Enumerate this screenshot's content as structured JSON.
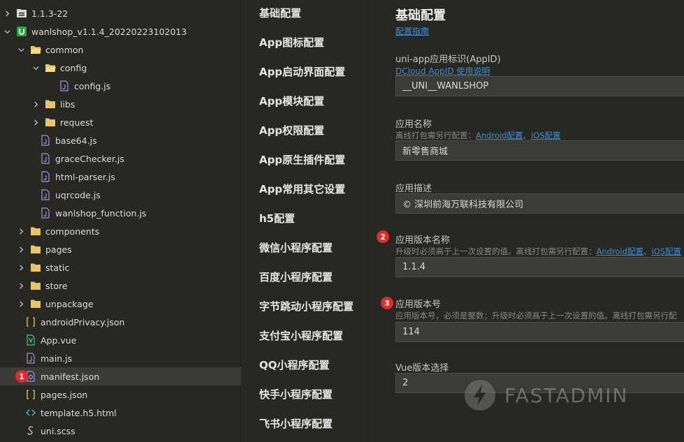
{
  "tree": {
    "rows": [
      {
        "label": "1.1.3-22"
      },
      {
        "label": "wanlshop_v1.1.4_20220223102013"
      },
      {
        "label": "common"
      },
      {
        "label": "config"
      },
      {
        "label": "config.js"
      },
      {
        "label": "libs"
      },
      {
        "label": "request"
      },
      {
        "label": "base64.js"
      },
      {
        "label": "graceChecker.js"
      },
      {
        "label": "html-parser.js"
      },
      {
        "label": "uqrcode.js"
      },
      {
        "label": "wanlshop_function.js"
      },
      {
        "label": "components"
      },
      {
        "label": "pages"
      },
      {
        "label": "static"
      },
      {
        "label": "store"
      },
      {
        "label": "unpackage"
      },
      {
        "label": "androidPrivacy.json"
      },
      {
        "label": "App.vue"
      },
      {
        "label": "main.js"
      },
      {
        "label": "manifest.json"
      },
      {
        "label": "pages.json"
      },
      {
        "label": "template.h5.html"
      },
      {
        "label": "uni.scss"
      }
    ]
  },
  "badges": {
    "one": "1",
    "two": "2",
    "three": "3"
  },
  "nav": {
    "items": [
      "基础配置",
      "App图标配置",
      "App启动界面配置",
      "App模块配置",
      "App权限配置",
      "App原生插件配置",
      "App常用其它设置",
      "h5配置",
      "微信小程序配置",
      "百度小程序配置",
      "字节跳动小程序配置",
      "支付宝小程序配置",
      "QQ小程序配置",
      "快手小程序配置",
      "飞书小程序配置"
    ]
  },
  "settings": {
    "title": "基础配置",
    "guide_link": "配置指南",
    "appid": {
      "label": "uni-app应用标识(AppID)",
      "link": "DCloud AppID 使用说明",
      "value": "__UNI__WANLSHOP"
    },
    "name": {
      "label": "应用名称",
      "hint_prefix": "离线打包需另行配置：",
      "hint_link1": "Android配置",
      "hint_sep": "、",
      "hint_link2": "iOS配置",
      "value": "新零售商城"
    },
    "desc": {
      "label": "应用描述",
      "value": "© 深圳前海万联科技有限公司"
    },
    "version_name": {
      "label": "应用版本名称",
      "hint_prefix": "升级时必须高于上一次设置的值。离线打包需另行配置：",
      "hint_link1": "Android配置",
      "hint_sep": "、",
      "hint_link2": "iOS配置",
      "value": "1.1.4"
    },
    "version_code": {
      "label": "应用版本号",
      "hint": "应用版本号，必须是整数；升级时必须高于上一次设置的值。离线打包需另行配",
      "value": "114"
    },
    "vue": {
      "label": "Vue版本选择",
      "value": "2"
    }
  },
  "watermark": {
    "text": "FASTADMIN"
  },
  "colors": {
    "background": "#272822",
    "accent_link": "#3b8fe0",
    "badge": "#e02b2b",
    "folder": "#e8c46a",
    "file_purple": "#a98be0",
    "vue_green": "#4fc08d"
  }
}
